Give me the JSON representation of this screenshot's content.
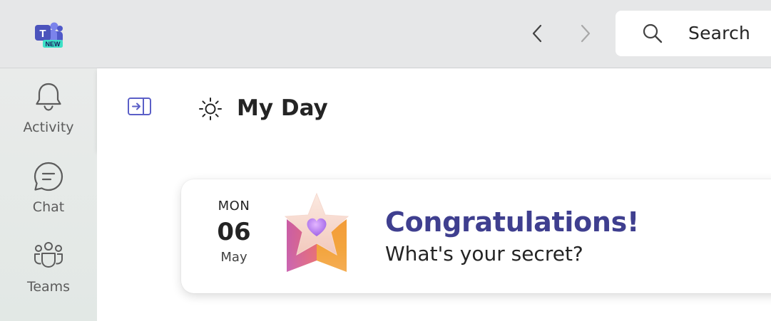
{
  "titlebar": {
    "logo_badge": "NEW",
    "search_label": "Search"
  },
  "rail": {
    "items": [
      {
        "label": "Activity",
        "icon": "bell-icon"
      },
      {
        "label": "Chat",
        "icon": "chat-icon"
      },
      {
        "label": "Teams",
        "icon": "teams-icon"
      }
    ]
  },
  "header": {
    "title": "My Day"
  },
  "card": {
    "dow": "MON",
    "day": "06",
    "month": "May",
    "title": "Congratulations!",
    "subtitle": "What's your secret?"
  },
  "colors": {
    "accent": "#5b5fc7",
    "card_title": "#3f3f8f",
    "titlebar_bg": "#e6e7e8"
  }
}
